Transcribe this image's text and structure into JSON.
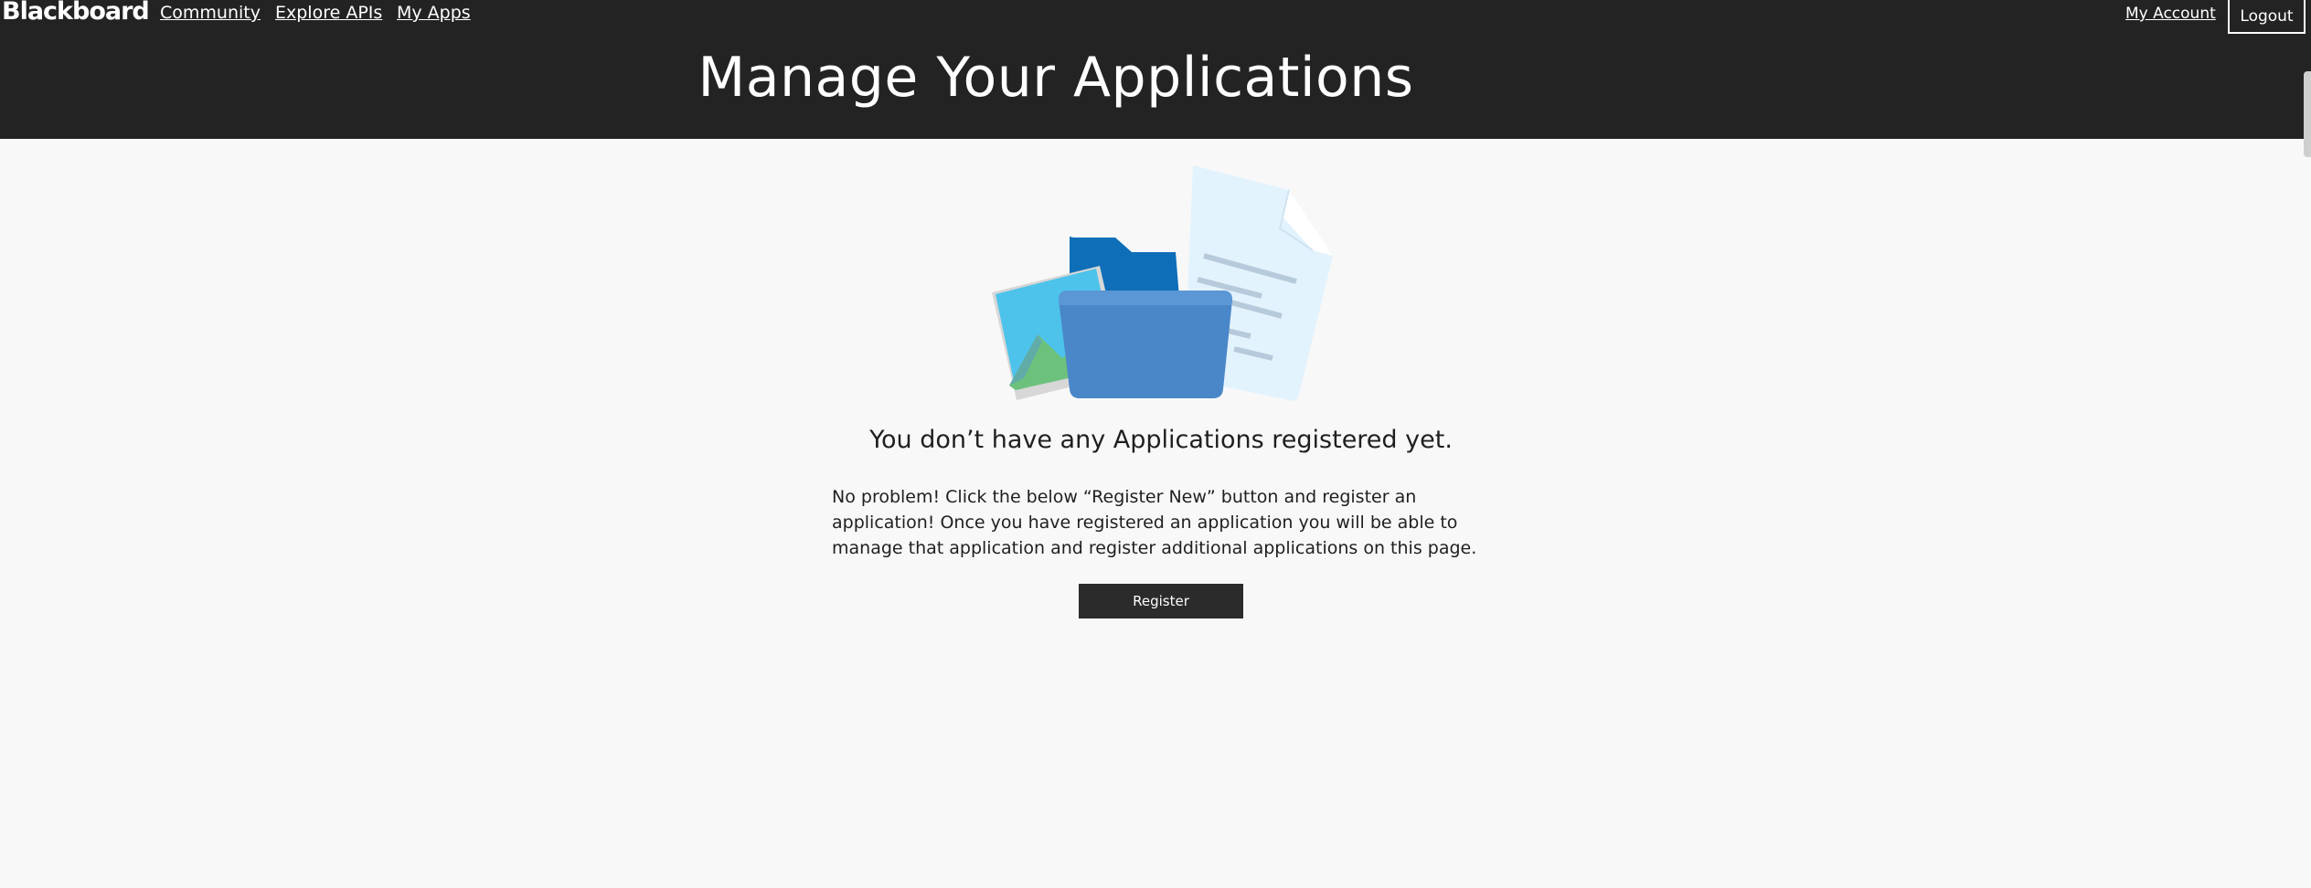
{
  "header": {
    "brand": "Blackboard",
    "nav": {
      "community": "Community",
      "explore_apis": "Explore APIs",
      "my_apps": "My Apps"
    },
    "account_link": "My Account",
    "logout_label": "Logout",
    "page_title": "Manage Your Applications"
  },
  "main": {
    "illustration_icon": "folder-with-documents-illustration",
    "empty_heading": "You don’t have any Applications registered yet.",
    "empty_body": "No problem! Click the below “Register New” button and register an application! Once you have registered an application you will be able to manage that application and register additional applications on this page.",
    "register_label": "Register"
  },
  "colors": {
    "header_bg": "#232323",
    "page_bg": "#f8f8f8",
    "button_bg": "#2b2b2b",
    "folder_blue": "#4a87c9",
    "folder_back": "#0e6eb8",
    "image_sky": "#4dc3eb",
    "image_grass": "#6cc27c",
    "document_bg": "#e3f3fd"
  }
}
